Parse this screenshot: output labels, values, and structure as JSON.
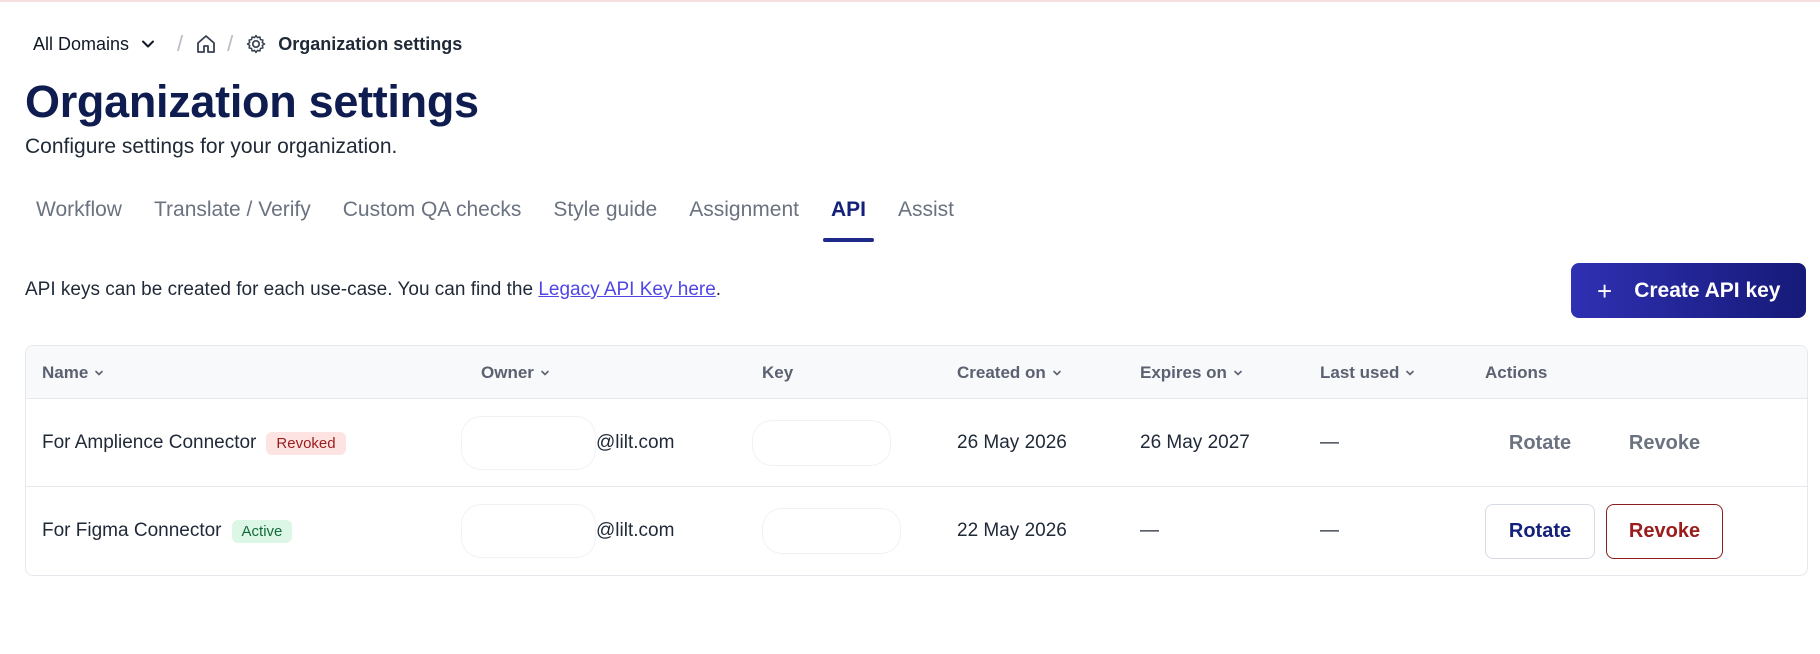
{
  "breadcrumb": {
    "domain": "All Domains",
    "separator": "/",
    "current": "Organization settings"
  },
  "header": {
    "title": "Organization settings",
    "subtitle": "Configure settings for your organization."
  },
  "tabs": [
    {
      "label": "Workflow"
    },
    {
      "label": "Translate / Verify"
    },
    {
      "label": "Custom QA checks"
    },
    {
      "label": "Style guide"
    },
    {
      "label": "Assignment"
    },
    {
      "label": "API"
    },
    {
      "label": "Assist"
    }
  ],
  "active_tab": "API",
  "info": {
    "text": "API keys can be created for each use-case. You can find the ",
    "link": "Legacy API Key here",
    "suffix": "."
  },
  "create_button": {
    "label": "Create API key",
    "icon": "plus-icon"
  },
  "table": {
    "columns": {
      "name": "Name",
      "owner": "Owner",
      "key": "Key",
      "created": "Created on",
      "expires": "Expires on",
      "last_used": "Last used",
      "actions": "Actions"
    },
    "rows": [
      {
        "name": "For Amplience Connector",
        "status": "Revoked",
        "owner": "@lilt.com",
        "created": "26 May 2026",
        "expires": "26 May 2027",
        "last_used": "—",
        "rotate": "Rotate",
        "revoke": "Revoke"
      },
      {
        "name": "For Figma Connector",
        "status": "Active",
        "owner": "@lilt.com",
        "created": "22 May 2026",
        "expires": "—",
        "last_used": "—",
        "rotate": "Rotate",
        "revoke": "Revoke"
      }
    ]
  },
  "colors": {
    "title": "#0e1c4f",
    "accent": "#1e2a8a",
    "link": "#4f46e5",
    "revoke": "#9b1c1c"
  }
}
